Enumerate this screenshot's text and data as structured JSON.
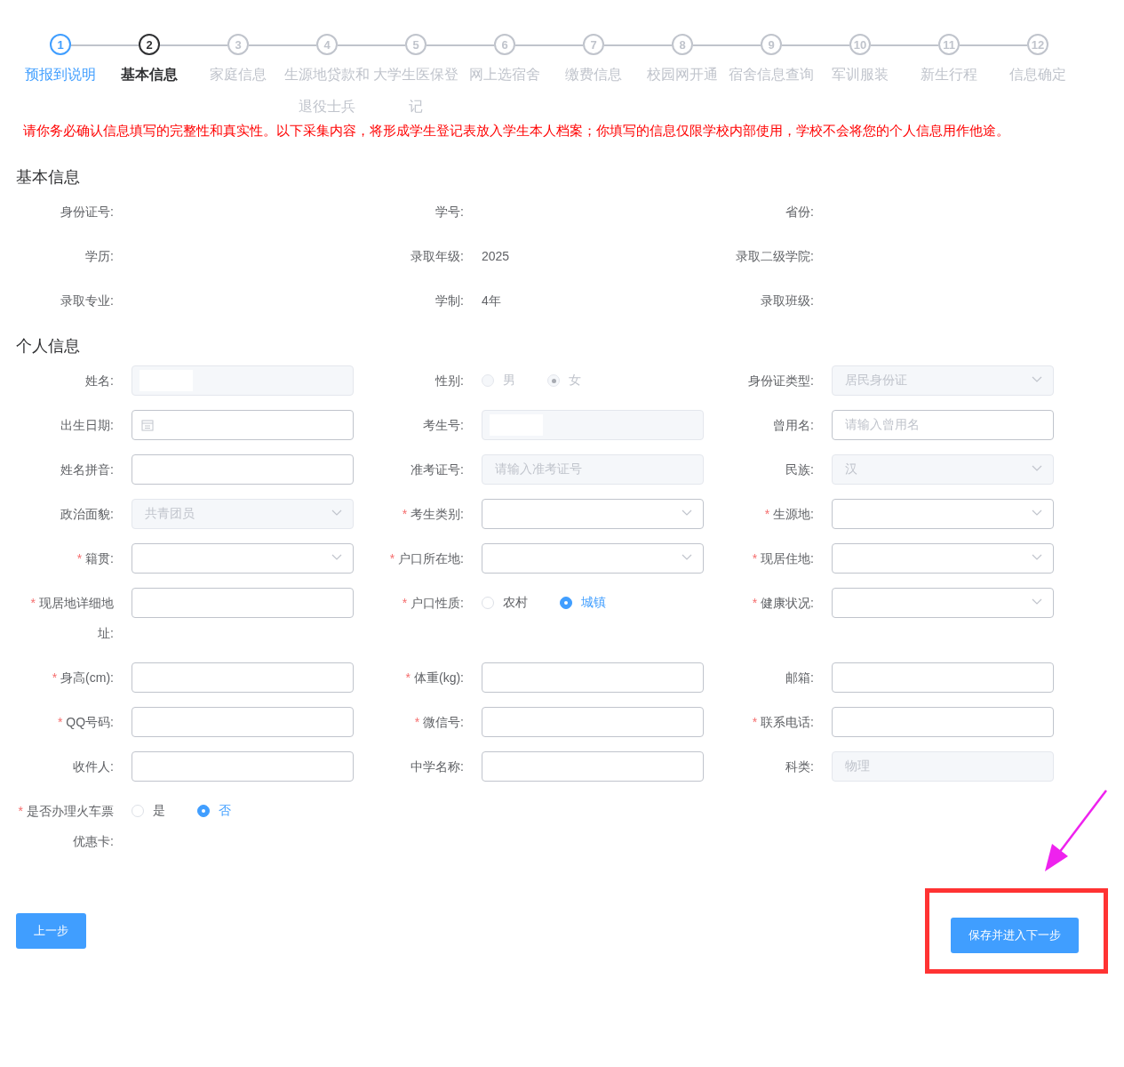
{
  "steps": [
    {
      "number": "1",
      "label": "预报到说明",
      "completed": true,
      "selected": false
    },
    {
      "number": "2",
      "label": "基本信息",
      "completed": false,
      "selected": true
    },
    {
      "number": "3",
      "label": "家庭信息",
      "completed": false,
      "selected": false
    },
    {
      "number": "4",
      "label": "生源地贷款和退役士兵",
      "completed": false,
      "selected": false
    },
    {
      "number": "5",
      "label": "大学生医保登记",
      "completed": false,
      "selected": false
    },
    {
      "number": "6",
      "label": "网上选宿舍",
      "completed": false,
      "selected": false
    },
    {
      "number": "7",
      "label": "缴费信息",
      "completed": false,
      "selected": false
    },
    {
      "number": "8",
      "label": "校园网开通",
      "completed": false,
      "selected": false
    },
    {
      "number": "9",
      "label": "宿舍信息查询",
      "completed": false,
      "selected": false
    },
    {
      "number": "10",
      "label": "军训服装",
      "completed": false,
      "selected": false
    },
    {
      "number": "11",
      "label": "新生行程",
      "completed": false,
      "selected": false
    },
    {
      "number": "12",
      "label": "信息确定",
      "completed": false,
      "selected": false
    }
  ],
  "notice": "请你务必确认信息填写的完整性和真实性。以下采集内容，将形成学生登记表放入学生本人档案；你填写的信息仅限学校内部使用，学校不会将您的个人信息用作他途。",
  "basic_info": {
    "title": "基本信息",
    "fields": [
      {
        "label": "身份证号:"
      },
      {
        "label": "学号:"
      },
      {
        "label": "省份:"
      },
      {
        "label": "学历:"
      },
      {
        "label": "录取年级:",
        "value": "2025"
      },
      {
        "label": "录取二级学院:"
      },
      {
        "label": "录取专业:"
      },
      {
        "label": "学制:",
        "value": "4年"
      },
      {
        "label": "录取班级:"
      }
    ]
  },
  "personal_info": {
    "title": "个人信息",
    "fields": [
      {
        "kind": "input",
        "label": "姓名:",
        "disabled": true,
        "redacted": true
      },
      {
        "kind": "radio",
        "label": "性别:",
        "disabled": true,
        "options": [
          {
            "label": "男",
            "selected": false
          },
          {
            "label": "女",
            "selected": true
          }
        ]
      },
      {
        "kind": "select",
        "label": "身份证类型:",
        "disabled": true,
        "value": "居民身份证"
      },
      {
        "kind": "date",
        "label": "出生日期:",
        "disabled": false
      },
      {
        "kind": "input",
        "label": "考生号:",
        "disabled": true,
        "redacted": true
      },
      {
        "kind": "input",
        "label": "曾用名:",
        "disabled": false,
        "placeholder": "请输入曾用名"
      },
      {
        "kind": "input",
        "label": "姓名拼音:",
        "disabled": false
      },
      {
        "kind": "input",
        "label": "准考证号:",
        "disabled": true,
        "placeholder": "请输入准考证号"
      },
      {
        "kind": "select",
        "label": "民族:",
        "disabled": true,
        "value": "汉"
      },
      {
        "kind": "select",
        "label": "政治面貌:",
        "disabled": true,
        "value": "共青团员"
      },
      {
        "kind": "select",
        "required_mark": "*",
        "label": "考生类别:",
        "disabled": false
      },
      {
        "kind": "select",
        "required_mark": "*",
        "label": "生源地:",
        "disabled": false
      },
      {
        "kind": "select",
        "required_mark": "*",
        "label": "籍贯:",
        "disabled": false
      },
      {
        "kind": "select",
        "required_mark": "*",
        "label": "户口所在地:",
        "disabled": false
      },
      {
        "kind": "select",
        "required_mark": "*",
        "label": "现居住地:",
        "disabled": false
      },
      {
        "kind": "input",
        "required_mark": "*",
        "label": "现居地详细地址:",
        "disabled": false
      },
      {
        "kind": "radio",
        "required_mark": "*",
        "label": "户口性质:",
        "disabled": false,
        "options": [
          {
            "label": "农村",
            "selected": false
          },
          {
            "label": "城镇",
            "selected": true
          }
        ]
      },
      {
        "kind": "select",
        "required_mark": "*",
        "label": "健康状况:",
        "disabled": false
      },
      {
        "kind": "input",
        "required_mark": "*",
        "label": "身高(cm):",
        "disabled": false
      },
      {
        "kind": "input",
        "required_mark": "*",
        "label": "体重(kg):",
        "disabled": false
      },
      {
        "kind": "input",
        "label": "邮箱:",
        "disabled": false
      },
      {
        "kind": "input",
        "required_mark": "*",
        "label": "QQ号码:",
        "disabled": false
      },
      {
        "kind": "input",
        "required_mark": "*",
        "label": "微信号:",
        "disabled": false
      },
      {
        "kind": "input",
        "required_mark": "*",
        "label": "联系电话:",
        "disabled": false
      },
      {
        "kind": "input",
        "label": "收件人:",
        "disabled": false
      },
      {
        "kind": "input",
        "label": "中学名称:",
        "disabled": false
      },
      {
        "kind": "input",
        "label": "科类:",
        "disabled": true,
        "value": "物理"
      },
      {
        "kind": "radio",
        "required_mark": "*",
        "label": "是否办理火车票优惠卡:",
        "disabled": false,
        "options": [
          {
            "label": "是",
            "selected": false
          },
          {
            "label": "否",
            "selected": true
          }
        ]
      }
    ]
  },
  "buttons": {
    "prev": "上一步",
    "next": "保存并进入下一步"
  }
}
